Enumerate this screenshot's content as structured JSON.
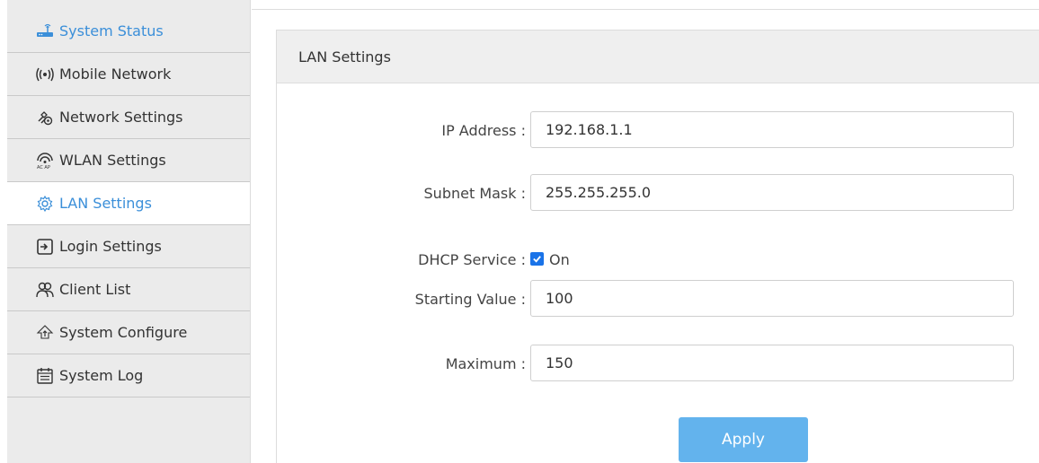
{
  "sidebar": {
    "items": [
      {
        "label": "System Status",
        "icon": "router-icon"
      },
      {
        "label": "Mobile Network",
        "icon": "signal-icon"
      },
      {
        "label": "Network Settings",
        "icon": "network-settings-icon"
      },
      {
        "label": "WLAN Settings",
        "icon": "wifi-icon"
      },
      {
        "label": "LAN Settings",
        "icon": "gear-icon"
      },
      {
        "label": "Login Settings",
        "icon": "login-icon"
      },
      {
        "label": "Client List",
        "icon": "users-icon"
      },
      {
        "label": "System Configure",
        "icon": "upload-cloud-icon"
      },
      {
        "label": "System Log",
        "icon": "calendar-log-icon"
      }
    ],
    "active_index": 4
  },
  "panel": {
    "title": "LAN Settings"
  },
  "form": {
    "ip_label": "IP Address :",
    "ip_value": "192.168.1.1",
    "mask_label": "Subnet Mask :",
    "mask_value": "255.255.255.0",
    "dhcp_label": "DHCP Service :",
    "dhcp_on_label": "On",
    "dhcp_checked": true,
    "start_label": "Starting Value :",
    "start_value": "100",
    "max_label": "Maximum :",
    "max_value": "150"
  },
  "actions": {
    "apply_label": "Apply"
  },
  "colors": {
    "accent": "#3b8fd9",
    "button": "#63b3ed",
    "sidebar_bg": "#ebebeb"
  }
}
